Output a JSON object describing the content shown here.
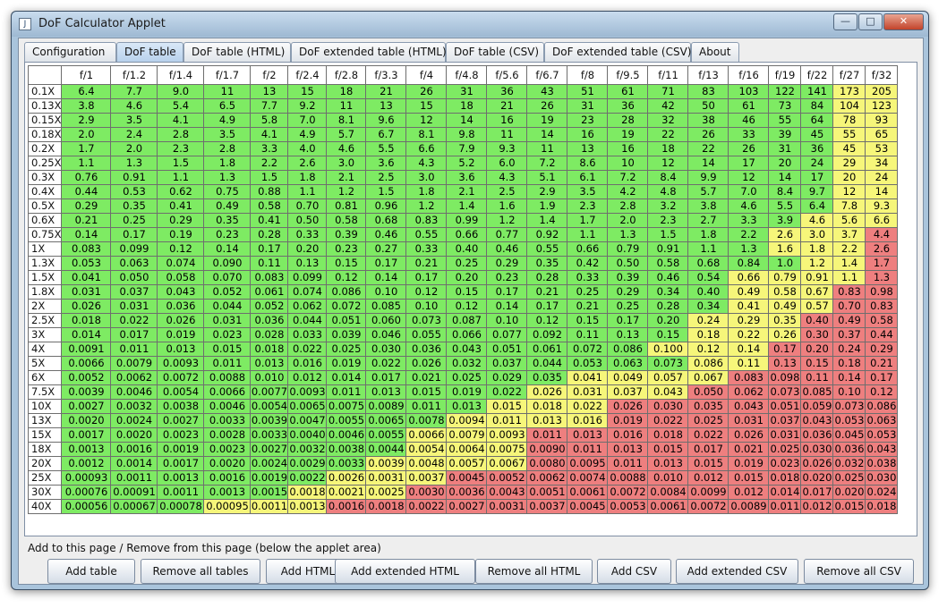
{
  "window": {
    "title": "DoF Calculator Applet",
    "icon": "java-applet-icon",
    "controls": {
      "minimize": "—",
      "maximize": "□",
      "close": "✕"
    }
  },
  "tabs": [
    {
      "label": "Configuration",
      "active": false
    },
    {
      "label": "DoF table",
      "active": true
    },
    {
      "label": "DoF table (HTML)",
      "active": false
    },
    {
      "label": "DoF extended table (HTML)",
      "active": false
    },
    {
      "label": "DoF table (CSV)",
      "active": false
    },
    {
      "label": "DoF extended table (CSV)",
      "active": false
    },
    {
      "label": "About",
      "active": false
    }
  ],
  "table": {
    "columns": [
      "f/1",
      "f/1.2",
      "f/1.4",
      "f/1.7",
      "f/2",
      "f/2.4",
      "f/2.8",
      "f/3.3",
      "f/4",
      "f/4.8",
      "f/5.6",
      "f/6.7",
      "f/8",
      "f/9.5",
      "f/11",
      "f/13",
      "f/16",
      "f/19",
      "f/22",
      "f/27",
      "f/32"
    ],
    "colors": {
      "g": "#7eeb63",
      "y": "#f6f67a",
      "r": "#ee7f7f"
    },
    "rows": [
      {
        "label": "0.1X",
        "values": [
          "6.4",
          "7.7",
          "9.0",
          "11",
          "13",
          "15",
          "18",
          "21",
          "26",
          "31",
          "36",
          "43",
          "51",
          "61",
          "71",
          "83",
          "103",
          "122",
          "141",
          "173",
          "205"
        ],
        "colors": "gggggggggggggggggggyy"
      },
      {
        "label": "0.13X",
        "values": [
          "3.8",
          "4.6",
          "5.4",
          "6.5",
          "7.7",
          "9.2",
          "11",
          "13",
          "15",
          "18",
          "21",
          "26",
          "31",
          "36",
          "42",
          "50",
          "61",
          "73",
          "84",
          "104",
          "123"
        ],
        "colors": "gggggggggggggggggggyy"
      },
      {
        "label": "0.15X",
        "values": [
          "2.9",
          "3.5",
          "4.1",
          "4.9",
          "5.8",
          "7.0",
          "8.1",
          "9.6",
          "12",
          "14",
          "16",
          "19",
          "23",
          "28",
          "32",
          "38",
          "46",
          "55",
          "64",
          "78",
          "93"
        ],
        "colors": "gggggggggggggggggggyy"
      },
      {
        "label": "0.18X",
        "values": [
          "2.0",
          "2.4",
          "2.8",
          "3.5",
          "4.1",
          "4.9",
          "5.7",
          "6.7",
          "8.1",
          "9.8",
          "11",
          "14",
          "16",
          "19",
          "22",
          "26",
          "33",
          "39",
          "45",
          "55",
          "65"
        ],
        "colors": "gggggggggggggggggggyy"
      },
      {
        "label": "0.2X",
        "values": [
          "1.7",
          "2.0",
          "2.3",
          "2.8",
          "3.3",
          "4.0",
          "4.6",
          "5.5",
          "6.6",
          "7.9",
          "9.3",
          "11",
          "13",
          "16",
          "18",
          "22",
          "26",
          "31",
          "36",
          "45",
          "53"
        ],
        "colors": "gggggggggggggggggggyy"
      },
      {
        "label": "0.25X",
        "values": [
          "1.1",
          "1.3",
          "1.5",
          "1.8",
          "2.2",
          "2.6",
          "3.0",
          "3.6",
          "4.3",
          "5.2",
          "6.0",
          "7.2",
          "8.6",
          "10",
          "12",
          "14",
          "17",
          "20",
          "24",
          "29",
          "34"
        ],
        "colors": "gggggggggggggggggggyy"
      },
      {
        "label": "0.3X",
        "values": [
          "0.76",
          "0.91",
          "1.1",
          "1.3",
          "1.5",
          "1.8",
          "2.1",
          "2.5",
          "3.0",
          "3.6",
          "4.3",
          "5.1",
          "6.1",
          "7.2",
          "8.4",
          "9.9",
          "12",
          "14",
          "17",
          "20",
          "24"
        ],
        "colors": "gggggggggggggggggggyy"
      },
      {
        "label": "0.4X",
        "values": [
          "0.44",
          "0.53",
          "0.62",
          "0.75",
          "0.88",
          "1.1",
          "1.2",
          "1.5",
          "1.8",
          "2.1",
          "2.5",
          "2.9",
          "3.5",
          "4.2",
          "4.8",
          "5.7",
          "7.0",
          "8.4",
          "9.7",
          "12",
          "14"
        ],
        "colors": "gggggggggggggggggggyy"
      },
      {
        "label": "0.5X",
        "values": [
          "0.29",
          "0.35",
          "0.41",
          "0.49",
          "0.58",
          "0.70",
          "0.81",
          "0.96",
          "1.2",
          "1.4",
          "1.6",
          "1.9",
          "2.3",
          "2.8",
          "3.2",
          "3.8",
          "4.6",
          "5.5",
          "6.4",
          "7.8",
          "9.3"
        ],
        "colors": "gggggggggggggggggggyy"
      },
      {
        "label": "0.6X",
        "values": [
          "0.21",
          "0.25",
          "0.29",
          "0.35",
          "0.41",
          "0.50",
          "0.58",
          "0.68",
          "0.83",
          "0.99",
          "1.2",
          "1.4",
          "1.7",
          "2.0",
          "2.3",
          "2.7",
          "3.3",
          "3.9",
          "4.6",
          "5.6",
          "6.6"
        ],
        "colors": "ggggggggggggggggggyyy"
      },
      {
        "label": "0.75X",
        "values": [
          "0.14",
          "0.17",
          "0.19",
          "0.23",
          "0.28",
          "0.33",
          "0.39",
          "0.46",
          "0.55",
          "0.66",
          "0.77",
          "0.92",
          "1.1",
          "1.3",
          "1.5",
          "1.8",
          "2.2",
          "2.6",
          "3.0",
          "3.7",
          "4.4"
        ],
        "colors": "gggggggggggggggggyyyr"
      },
      {
        "label": "1X",
        "values": [
          "0.083",
          "0.099",
          "0.12",
          "0.14",
          "0.17",
          "0.20",
          "0.23",
          "0.27",
          "0.33",
          "0.40",
          "0.46",
          "0.55",
          "0.66",
          "0.79",
          "0.91",
          "1.1",
          "1.3",
          "1.6",
          "1.8",
          "2.2",
          "2.6"
        ],
        "colors": "gggggggggggggggggyyyr"
      },
      {
        "label": "1.3X",
        "values": [
          "0.053",
          "0.063",
          "0.074",
          "0.090",
          "0.11",
          "0.13",
          "0.15",
          "0.17",
          "0.21",
          "0.25",
          "0.29",
          "0.35",
          "0.42",
          "0.50",
          "0.58",
          "0.68",
          "0.84",
          "1.0",
          "1.2",
          "1.4",
          "1.7"
        ],
        "colors": "ggggggggggggggggggyyr"
      },
      {
        "label": "1.5X",
        "values": [
          "0.041",
          "0.050",
          "0.058",
          "0.070",
          "0.083",
          "0.099",
          "0.12",
          "0.14",
          "0.17",
          "0.20",
          "0.23",
          "0.28",
          "0.33",
          "0.39",
          "0.46",
          "0.54",
          "0.66",
          "0.79",
          "0.91",
          "1.1",
          "1.3"
        ],
        "colors": "ggggggggggggggggyyyyr"
      },
      {
        "label": "1.8X",
        "values": [
          "0.031",
          "0.037",
          "0.043",
          "0.052",
          "0.061",
          "0.074",
          "0.086",
          "0.10",
          "0.12",
          "0.15",
          "0.17",
          "0.21",
          "0.25",
          "0.29",
          "0.34",
          "0.40",
          "0.49",
          "0.58",
          "0.67",
          "0.83",
          "0.98"
        ],
        "colors": "ggggggggggggggggyyyrr"
      },
      {
        "label": "2X",
        "values": [
          "0.026",
          "0.031",
          "0.036",
          "0.044",
          "0.052",
          "0.062",
          "0.072",
          "0.085",
          "0.10",
          "0.12",
          "0.14",
          "0.17",
          "0.21",
          "0.25",
          "0.28",
          "0.34",
          "0.41",
          "0.49",
          "0.57",
          "0.70",
          "0.83"
        ],
        "colors": "ggggggggggggggggyyyrr"
      },
      {
        "label": "2.5X",
        "values": [
          "0.018",
          "0.022",
          "0.026",
          "0.031",
          "0.036",
          "0.044",
          "0.051",
          "0.060",
          "0.073",
          "0.087",
          "0.10",
          "0.12",
          "0.15",
          "0.17",
          "0.20",
          "0.24",
          "0.29",
          "0.35",
          "0.40",
          "0.49",
          "0.58"
        ],
        "colors": "gggggggggggggggyyyrrr"
      },
      {
        "label": "3X",
        "values": [
          "0.014",
          "0.017",
          "0.019",
          "0.023",
          "0.028",
          "0.033",
          "0.039",
          "0.046",
          "0.055",
          "0.066",
          "0.077",
          "0.092",
          "0.11",
          "0.13",
          "0.15",
          "0.18",
          "0.22",
          "0.26",
          "0.30",
          "0.37",
          "0.44"
        ],
        "colors": "gggggggggggggggyyyrrr"
      },
      {
        "label": "4X",
        "values": [
          "0.0091",
          "0.011",
          "0.013",
          "0.015",
          "0.018",
          "0.022",
          "0.025",
          "0.030",
          "0.036",
          "0.043",
          "0.051",
          "0.061",
          "0.072",
          "0.086",
          "0.100",
          "0.12",
          "0.14",
          "0.17",
          "0.20",
          "0.24",
          "0.29"
        ],
        "colors": "ggggggggggggggyyyrrrr"
      },
      {
        "label": "5X",
        "values": [
          "0.0066",
          "0.0079",
          "0.0093",
          "0.011",
          "0.013",
          "0.016",
          "0.019",
          "0.022",
          "0.026",
          "0.032",
          "0.037",
          "0.044",
          "0.053",
          "0.063",
          "0.073",
          "0.086",
          "0.11",
          "0.13",
          "0.15",
          "0.18",
          "0.21"
        ],
        "colors": "gggggggggggggggyyrrrr"
      },
      {
        "label": "6X",
        "values": [
          "0.0052",
          "0.0062",
          "0.0072",
          "0.0088",
          "0.010",
          "0.012",
          "0.014",
          "0.017",
          "0.021",
          "0.025",
          "0.029",
          "0.035",
          "0.041",
          "0.049",
          "0.057",
          "0.067",
          "0.083",
          "0.098",
          "0.11",
          "0.14",
          "0.17"
        ],
        "colors": "ggggggggggggyyyyrrrrr"
      },
      {
        "label": "7.5X",
        "values": [
          "0.0039",
          "0.0046",
          "0.0054",
          "0.0066",
          "0.0077",
          "0.0093",
          "0.011",
          "0.013",
          "0.015",
          "0.019",
          "0.022",
          "0.026",
          "0.031",
          "0.037",
          "0.043",
          "0.050",
          "0.062",
          "0.073",
          "0.085",
          "0.10",
          "0.12"
        ],
        "colors": "gggggggggggyyyyrrrrrr"
      },
      {
        "label": "10X",
        "values": [
          "0.0027",
          "0.0032",
          "0.0038",
          "0.0046",
          "0.0054",
          "0.0065",
          "0.0075",
          "0.0089",
          "0.011",
          "0.013",
          "0.015",
          "0.018",
          "0.022",
          "0.026",
          "0.030",
          "0.035",
          "0.043",
          "0.051",
          "0.059",
          "0.073",
          "0.086"
        ],
        "colors": "ggggggggggyyyrrrrrrrr"
      },
      {
        "label": "13X",
        "values": [
          "0.0020",
          "0.0024",
          "0.0027",
          "0.0033",
          "0.0039",
          "0.0047",
          "0.0055",
          "0.0065",
          "0.0078",
          "0.0094",
          "0.011",
          "0.013",
          "0.016",
          "0.019",
          "0.022",
          "0.025",
          "0.031",
          "0.037",
          "0.043",
          "0.053",
          "0.063"
        ],
        "colors": "gggggggggyyyyrrrrrrrr"
      },
      {
        "label": "15X",
        "values": [
          "0.0017",
          "0.0020",
          "0.0023",
          "0.0028",
          "0.0033",
          "0.0040",
          "0.0046",
          "0.0055",
          "0.0066",
          "0.0079",
          "0.0093",
          "0.011",
          "0.013",
          "0.016",
          "0.018",
          "0.022",
          "0.026",
          "0.031",
          "0.036",
          "0.045",
          "0.053"
        ],
        "colors": "ggggggggyyyrrrrrrrrrr"
      },
      {
        "label": "18X",
        "values": [
          "0.0013",
          "0.0016",
          "0.0019",
          "0.0023",
          "0.0027",
          "0.0032",
          "0.0038",
          "0.0044",
          "0.0054",
          "0.0064",
          "0.0075",
          "0.0090",
          "0.011",
          "0.013",
          "0.015",
          "0.017",
          "0.021",
          "0.025",
          "0.030",
          "0.036",
          "0.043"
        ],
        "colors": "ggggggggyyyrrrrrrrrrr"
      },
      {
        "label": "20X",
        "values": [
          "0.0012",
          "0.0014",
          "0.0017",
          "0.0020",
          "0.0024",
          "0.0029",
          "0.0033",
          "0.0039",
          "0.0048",
          "0.0057",
          "0.0067",
          "0.0080",
          "0.0095",
          "0.011",
          "0.013",
          "0.015",
          "0.019",
          "0.023",
          "0.026",
          "0.032",
          "0.038"
        ],
        "colors": "gggggggyyyyrrrrrrrrrr"
      },
      {
        "label": "25X",
        "values": [
          "0.00093",
          "0.0011",
          "0.0013",
          "0.0016",
          "0.0019",
          "0.0022",
          "0.0026",
          "0.0031",
          "0.0037",
          "0.0045",
          "0.0052",
          "0.0062",
          "0.0074",
          "0.0088",
          "0.010",
          "0.012",
          "0.015",
          "0.018",
          "0.020",
          "0.025",
          "0.030"
        ],
        "colors": "ggggggyyyrrrrrrrrrrrr"
      },
      {
        "label": "30X",
        "values": [
          "0.00076",
          "0.00091",
          "0.0011",
          "0.0013",
          "0.0015",
          "0.0018",
          "0.0021",
          "0.0025",
          "0.0030",
          "0.0036",
          "0.0043",
          "0.0051",
          "0.0061",
          "0.0072",
          "0.0084",
          "0.0099",
          "0.012",
          "0.014",
          "0.017",
          "0.020",
          "0.024"
        ],
        "colors": "gggggyyyrrrrrrrrrrrrr"
      },
      {
        "label": "40X",
        "values": [
          "0.00056",
          "0.00067",
          "0.00078",
          "0.00095",
          "0.0011",
          "0.0013",
          "0.0016",
          "0.0018",
          "0.0022",
          "0.0027",
          "0.0031",
          "0.0037",
          "0.0045",
          "0.0053",
          "0.0061",
          "0.0072",
          "0.0089",
          "0.011",
          "0.012",
          "0.015",
          "0.018"
        ],
        "colors": "gggyyyrrrrrrrrrrrrrrr"
      }
    ]
  },
  "bottom": {
    "group_label": "Add to this page / Remove from this page (below the applet area)",
    "buttons": [
      {
        "label": "Add table"
      },
      {
        "label": "Remove all tables"
      },
      {
        "label": "Add HTML"
      },
      {
        "label": "Add extended HTML"
      },
      {
        "label": "Remove all HTML"
      },
      {
        "label": "Add CSV"
      },
      {
        "label": "Add extended CSV"
      },
      {
        "label": "Remove all CSV"
      }
    ]
  }
}
